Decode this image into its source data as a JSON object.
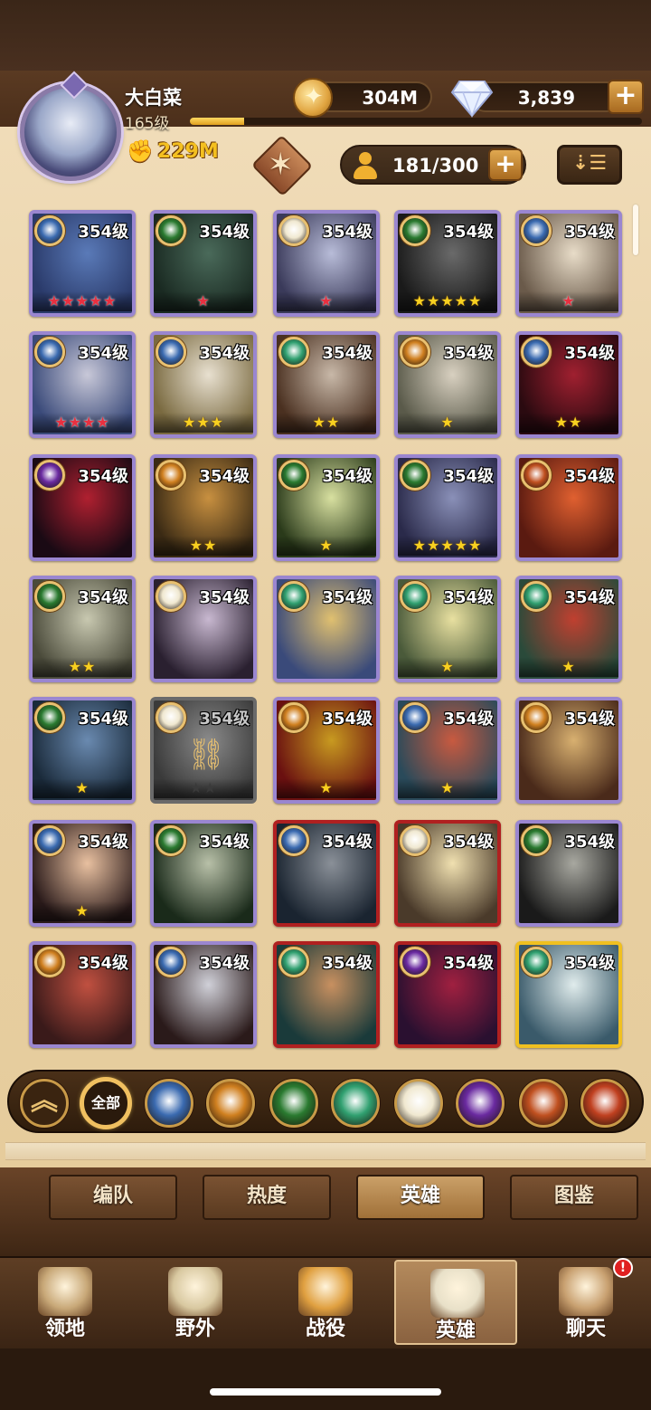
{
  "player": {
    "name": "大白菜",
    "level_label": "165级",
    "xp_progress": 0.12,
    "power": "229M"
  },
  "currencies": {
    "gold": "304M",
    "diamonds": "3,839",
    "plus": "+"
  },
  "roster": {
    "count": "181/300",
    "plus": "+"
  },
  "sort_label": "⇣☰",
  "heroes": [
    {
      "level": "354级",
      "faction": "lightbearer",
      "stars": "★★★★★",
      "star_color": "red",
      "frame": "purple",
      "art": [
        "#5a7ab8",
        "#2a3a6a"
      ]
    },
    {
      "level": "354级",
      "faction": "wilder",
      "stars": "★",
      "star_color": "red",
      "frame": "purple",
      "art": [
        "#4a6a5a",
        "#1a2a22"
      ]
    },
    {
      "level": "354级",
      "faction": "celestial",
      "stars": "★",
      "star_color": "red",
      "frame": "purple",
      "art": [
        "#b8bcd8",
        "#3a3a5a"
      ]
    },
    {
      "level": "354级",
      "faction": "wilder",
      "stars": "★★★★★",
      "star_color": "yellow",
      "frame": "purple",
      "art": [
        "#6a6a6a",
        "#1a1a1a"
      ]
    },
    {
      "level": "354级",
      "faction": "lightbearer",
      "stars": "★",
      "star_color": "red",
      "frame": "purple",
      "art": [
        "#e8dcc8",
        "#6a5a4a"
      ]
    },
    {
      "level": "354级",
      "faction": "lightbearer",
      "stars": "★★★★",
      "star_color": "red",
      "frame": "purple",
      "art": [
        "#c8c8d8",
        "#3a4a7a"
      ]
    },
    {
      "level": "354级",
      "faction": "lightbearer",
      "stars": "★★★",
      "star_color": "yellow",
      "frame": "purple",
      "art": [
        "#e8e0d0",
        "#7a6a40"
      ]
    },
    {
      "level": "354级",
      "faction": "graveborn",
      "stars": "★★",
      "star_color": "yellow",
      "frame": "purple",
      "art": [
        "#c8b8a8",
        "#4a3020"
      ]
    },
    {
      "level": "354级",
      "faction": "mauler",
      "stars": "★",
      "star_color": "yellow",
      "frame": "purple",
      "art": [
        "#d8d0c0",
        "#5a5a4a"
      ]
    },
    {
      "level": "354级",
      "faction": "lightbearer",
      "stars": "★★",
      "star_color": "yellow",
      "frame": "purple",
      "art": [
        "#a02030",
        "#2a0a10"
      ]
    },
    {
      "level": "354级",
      "faction": "hypogean",
      "stars": "",
      "star_color": "yellow",
      "frame": "purple",
      "art": [
        "#b02030",
        "#1a0a14"
      ]
    },
    {
      "level": "354级",
      "faction": "mauler",
      "stars": "★★",
      "star_color": "yellow",
      "frame": "purple",
      "art": [
        "#c89040",
        "#3a2a14"
      ]
    },
    {
      "level": "354级",
      "faction": "wilder",
      "stars": "★",
      "star_color": "yellow",
      "frame": "purple",
      "art": [
        "#d8e0a0",
        "#2a3a1a"
      ]
    },
    {
      "level": "354级",
      "faction": "wilder",
      "stars": "★★★★★",
      "star_color": "yellow",
      "frame": "purple",
      "art": [
        "#8a90b8",
        "#2a2a4a"
      ]
    },
    {
      "level": "354级",
      "faction": "dimensional",
      "stars": "",
      "star_color": "yellow",
      "frame": "purple",
      "art": [
        "#e06030",
        "#5a1a10"
      ]
    },
    {
      "level": "354级",
      "faction": "wilder",
      "stars": "★★",
      "star_color": "yellow",
      "frame": "purple",
      "art": [
        "#c8c8b0",
        "#4a4a3a"
      ]
    },
    {
      "level": "354级",
      "faction": "celestial",
      "stars": "",
      "star_color": "yellow",
      "frame": "purple",
      "art": [
        "#c8b8d0",
        "#2a2030"
      ]
    },
    {
      "level": "354级",
      "faction": "graveborn",
      "stars": "",
      "star_color": "yellow",
      "frame": "purple",
      "art": [
        "#e0c070",
        "#3a4a7a"
      ]
    },
    {
      "level": "354级",
      "faction": "graveborn",
      "stars": "★",
      "star_color": "yellow",
      "frame": "purple",
      "art": [
        "#e8e0a0",
        "#4a5a3a"
      ]
    },
    {
      "level": "354级",
      "faction": "graveborn",
      "stars": "★",
      "star_color": "yellow",
      "frame": "purple",
      "art": [
        "#c04030",
        "#2a4a3a"
      ]
    },
    {
      "level": "354级",
      "faction": "wilder",
      "stars": "★",
      "star_color": "yellow",
      "frame": "purple",
      "art": [
        "#6a8ab0",
        "#1a2a3a"
      ]
    },
    {
      "level": "354级",
      "faction": "celestial",
      "stars": "★★",
      "star_color": "gray",
      "frame": "locked",
      "art": [
        "#8a8a8a",
        "#3a3a3a"
      ]
    },
    {
      "level": "354级",
      "faction": "mauler",
      "stars": "★",
      "star_color": "yellow",
      "frame": "purple",
      "art": [
        "#c89a20",
        "#6a1010"
      ]
    },
    {
      "level": "354级",
      "faction": "lightbearer",
      "stars": "★",
      "star_color": "yellow",
      "frame": "purple",
      "art": [
        "#c85a40",
        "#2a4a5a"
      ]
    },
    {
      "level": "354级",
      "faction": "mauler",
      "stars": "",
      "star_color": "yellow",
      "frame": "purple",
      "art": [
        "#d8b070",
        "#4a2a1a"
      ]
    },
    {
      "level": "354级",
      "faction": "lightbearer",
      "stars": "★",
      "star_color": "yellow",
      "frame": "purple",
      "art": [
        "#e8c0a0",
        "#2a1a1a"
      ]
    },
    {
      "level": "354级",
      "faction": "wilder",
      "stars": "",
      "star_color": "yellow",
      "frame": "purple",
      "art": [
        "#b8c0a8",
        "#1a2a1a"
      ]
    },
    {
      "level": "354级",
      "faction": "lightbearer",
      "stars": "",
      "star_color": "yellow",
      "frame": "red",
      "art": [
        "#8a9098",
        "#1a2430"
      ]
    },
    {
      "level": "354级",
      "faction": "celestial",
      "stars": "",
      "star_color": "yellow",
      "frame": "red",
      "art": [
        "#f0e0b0",
        "#4a3a2a"
      ]
    },
    {
      "level": "354级",
      "faction": "wilder",
      "stars": "",
      "star_color": "yellow",
      "frame": "purple",
      "art": [
        "#a8a8a0",
        "#1a1a1a"
      ]
    },
    {
      "level": "354级",
      "faction": "mauler",
      "stars": "",
      "star_color": "yellow",
      "frame": "purple",
      "art": [
        "#c05040",
        "#3a1a1a"
      ]
    },
    {
      "level": "354级",
      "faction": "lightbearer",
      "stars": "",
      "star_color": "yellow",
      "frame": "purple",
      "art": [
        "#d0d0d8",
        "#2a1a1a"
      ]
    },
    {
      "level": "354级",
      "faction": "graveborn",
      "stars": "",
      "star_color": "yellow",
      "frame": "red",
      "art": [
        "#c89060",
        "#1a3a3a"
      ]
    },
    {
      "level": "354级",
      "faction": "hypogean",
      "stars": "",
      "star_color": "yellow",
      "frame": "red",
      "art": [
        "#a02040",
        "#2a1030"
      ]
    },
    {
      "level": "354级",
      "faction": "graveborn",
      "stars": "",
      "star_color": "yellow",
      "frame": "gold",
      "art": [
        "#e0ecec",
        "#3a5a6a"
      ]
    }
  ],
  "faction_filters": [
    {
      "name": "scroll-up",
      "label": "︽"
    },
    {
      "name": "all",
      "label": "全部"
    },
    {
      "name": "lightbearer",
      "label": ""
    },
    {
      "name": "mauler",
      "label": ""
    },
    {
      "name": "wilder",
      "label": ""
    },
    {
      "name": "graveborn",
      "label": ""
    },
    {
      "name": "celestial",
      "label": ""
    },
    {
      "name": "hypogean",
      "label": ""
    },
    {
      "name": "dimensional",
      "label": ""
    },
    {
      "name": "dragon",
      "label": ""
    }
  ],
  "subtabs": [
    {
      "label": "编队",
      "active": false
    },
    {
      "label": "热度",
      "active": false
    },
    {
      "label": "英雄",
      "active": true
    },
    {
      "label": "图鉴",
      "active": false
    }
  ],
  "nav": [
    {
      "label": "领地",
      "active": false
    },
    {
      "label": "野外",
      "active": false
    },
    {
      "label": "战役",
      "active": false
    },
    {
      "label": "英雄",
      "active": true
    },
    {
      "label": "聊天",
      "active": false
    }
  ],
  "chat_badge": "!",
  "faction_colors": {
    "lightbearer": "#3a6ab0",
    "mauler": "#d08020",
    "wilder": "#2a7a30",
    "graveborn": "#30a070",
    "celestial": "#f0e8d0",
    "hypogean": "#6a2aa0",
    "dimensional": "#c05020",
    "dragon": "#c04020"
  }
}
